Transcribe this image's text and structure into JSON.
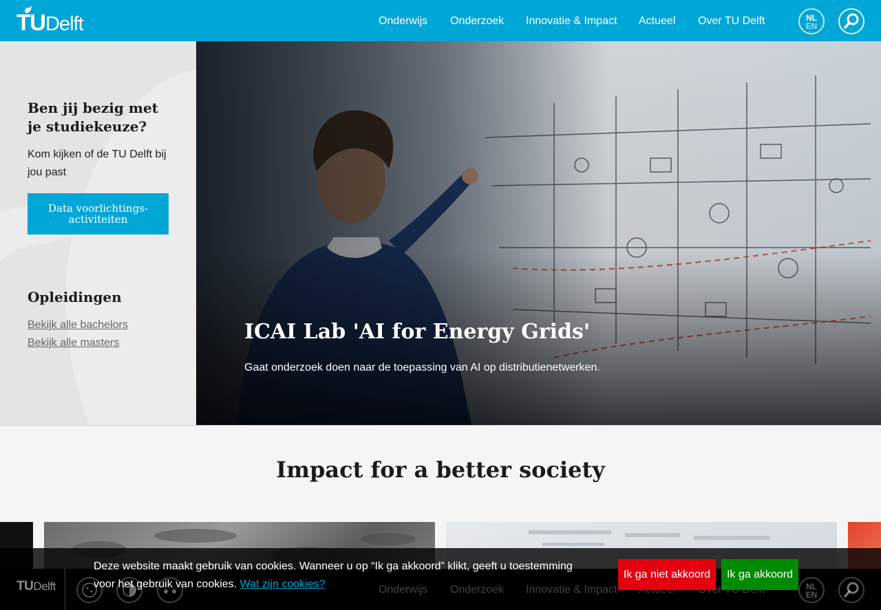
{
  "header": {
    "logo_text_tu": "TU",
    "logo_text_delft": "Delft",
    "nav": [
      "Onderwijs",
      "Onderzoek",
      "Innovatie & Impact",
      "Actueel",
      "Over TU Delft"
    ],
    "lang_active": "NL",
    "lang_other": "EN",
    "colors": {
      "brand": "#00a6d6"
    }
  },
  "sidebar": {
    "heading": "Ben jij bezig met je studiekeuze?",
    "text": "Kom kijken of de TU Delft bij jou past",
    "button_label": "Data voorlichtings-activiteiten",
    "programs_heading": "Opleidingen",
    "links": [
      "Bekijk alle bachelors",
      "Bekijk alle masters"
    ]
  },
  "hero": {
    "title": "ICAI Lab 'AI for Energy Grids'",
    "subtitle": "Gaat onderzoek doen naar de toepassing van AI op distributienetwerken."
  },
  "impact": {
    "title": "Impact for a better society"
  },
  "cookie": {
    "message": "Deze website maakt gebruik van cookies. Wanneer u op “Ik ga akkoord” klikt, geeft u toestemming voor het gebruik van cookies.",
    "link_label": "Wat zijn cookies?",
    "decline_label": "Ik ga niet akkoord",
    "accept_label": "Ik ga akkoord",
    "colors": {
      "decline": "#e3000f",
      "accept": "#008a00"
    }
  },
  "footer": {
    "logo_text_tu": "TU",
    "logo_text_delft": "Delft",
    "nav": [
      "Onderwijs",
      "Onderzoek",
      "Innovatie & Impact",
      "Actueel",
      "Over TU Delft"
    ],
    "lang_active": "NL",
    "lang_other": "EN"
  }
}
